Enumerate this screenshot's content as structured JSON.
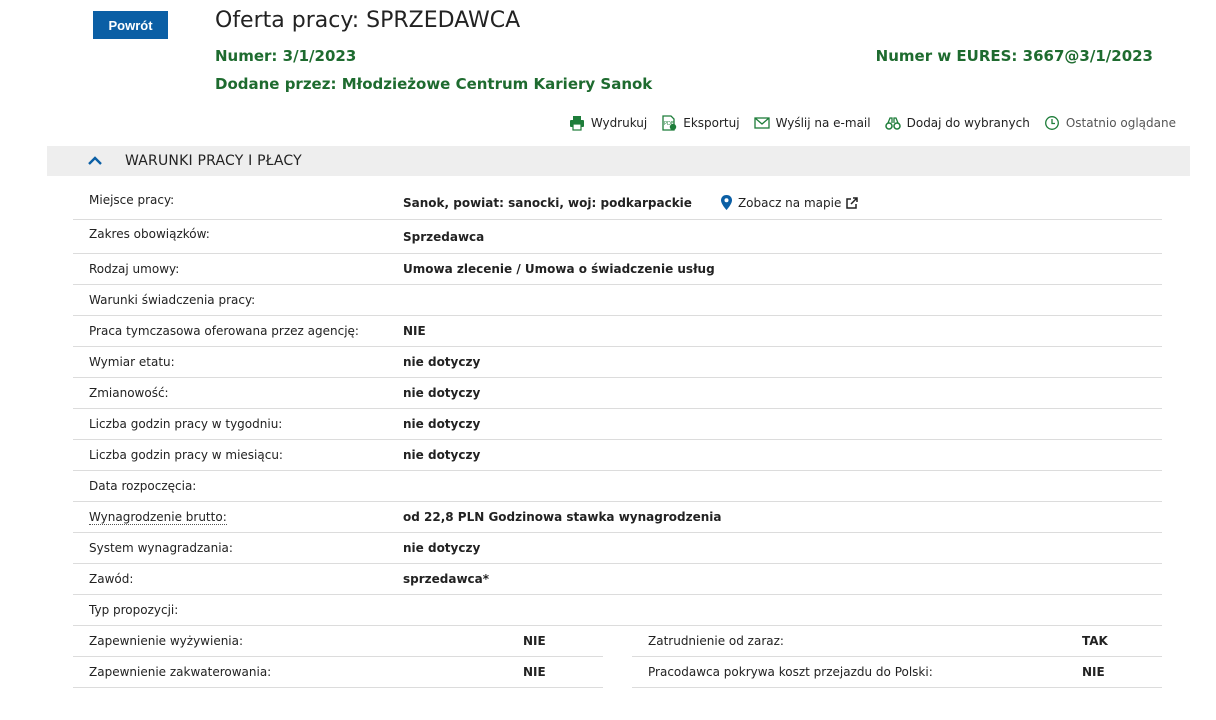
{
  "back_label": "Powrót",
  "title": "Oferta pracy: SPRZEDAWCA",
  "numer_label": "Numer:",
  "numer_value": "3/1/2023",
  "eures_label": "Numer w EURES:",
  "eures_value": "3667@3/1/2023",
  "dodane_label": "Dodane przez:",
  "dodane_value": "Młodzieżowe Centrum Kariery Sanok",
  "actions": {
    "print": "Wydrukuj",
    "export": "Eksportuj",
    "email": "Wyślij na e-mail",
    "favorites": "Dodaj do wybranych",
    "recent": "Ostatnio oglądane"
  },
  "section_title": "WARUNKI PRACY I PŁACY",
  "map_link": "Zobacz na mapie",
  "rows": [
    {
      "label": "Miejsce pracy:",
      "value": "Sanok, powiat: sanocki, woj: podkarpackie"
    },
    {
      "label": "Zakres obowiązków:",
      "value": "Sprzedawca"
    },
    {
      "label": "Rodzaj umowy:",
      "value": "Umowa zlecenie / Umowa o świadczenie usług"
    },
    {
      "label": "Warunki świadczenia pracy:",
      "value": ""
    },
    {
      "label": "Praca tymczasowa oferowana przez agencję:",
      "value": "NIE"
    },
    {
      "label": "Wymiar etatu:",
      "value": "nie dotyczy"
    },
    {
      "label": "Zmianowość:",
      "value": "nie dotyczy"
    },
    {
      "label": "Liczba godzin pracy w tygodniu:",
      "value": "nie dotyczy"
    },
    {
      "label": "Liczba godzin pracy w miesiącu:",
      "value": "nie dotyczy"
    },
    {
      "label": "Data rozpoczęcia:",
      "value": ""
    },
    {
      "label": "Wynagrodzenie brutto:",
      "value": "od 22,8 PLN Godzinowa stawka wynagrodzenia"
    },
    {
      "label": "System wynagradzania:",
      "value": "nie dotyczy"
    },
    {
      "label": "Zawód:",
      "value": "sprzedawca*"
    },
    {
      "label": "Typ propozycji:",
      "value": ""
    }
  ],
  "pairs": [
    {
      "left_label": "Zapewnienie wyżywienia:",
      "left_value": "NIE",
      "right_label": "Zatrudnienie od zaraz:",
      "right_value": "TAK"
    },
    {
      "left_label": "Zapewnienie zakwaterowania:",
      "left_value": "NIE",
      "right_label": "Pracodawca pokrywa koszt przejazdu do Polski:",
      "right_value": "NIE"
    }
  ],
  "colors": {
    "accent": "#0b5fa5",
    "green": "#1e6b2f",
    "section_bg": "#eeeeee"
  }
}
